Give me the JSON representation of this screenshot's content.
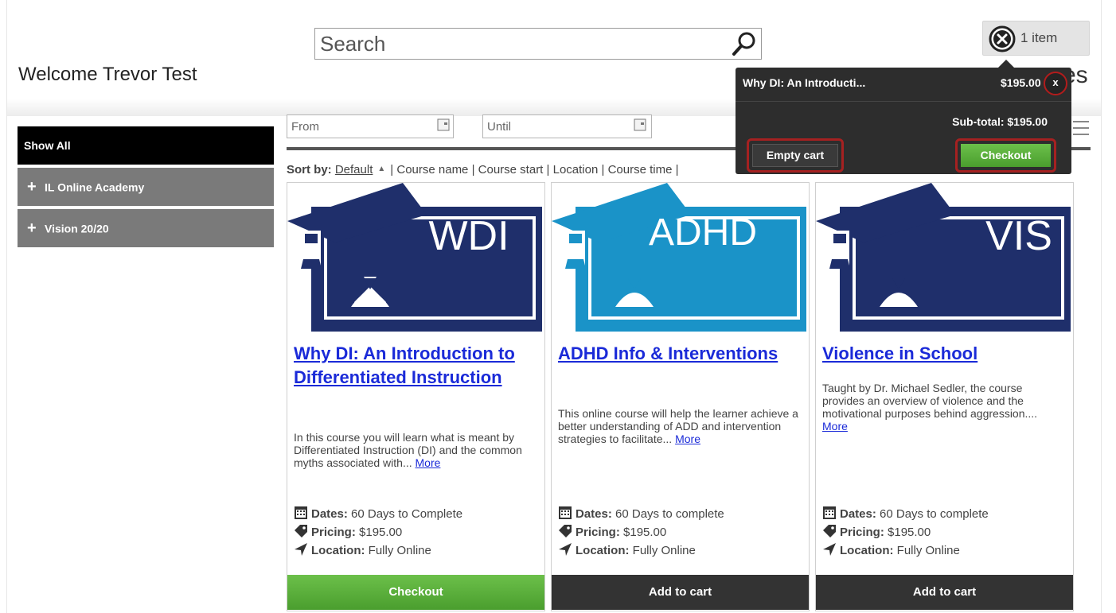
{
  "header": {
    "search_placeholder": "Search",
    "welcome": "Welcome Trevor Test",
    "cart_label": "1 item",
    "title_tail": "es"
  },
  "sidebar": {
    "show_all": "Show All",
    "items": [
      {
        "label": "IL Online Academy"
      },
      {
        "label": "Vision 20/20"
      }
    ]
  },
  "filters": {
    "from_placeholder": "From",
    "until_placeholder": "Until"
  },
  "sort": {
    "label": "Sort by:",
    "default": "Default",
    "options": [
      "Course name",
      "Course start",
      "Location",
      "Course time"
    ],
    "separator": "|"
  },
  "cart_popover": {
    "item_name": "Why DI: An Introducti...",
    "item_price": "$195.00",
    "remove_label": "x",
    "subtotal": "Sub-total: $195.00",
    "empty_cart_label": "Empty cart",
    "checkout_label": "Checkout"
  },
  "courses": [
    {
      "badge": "WDI",
      "badge_color": "#1f2f6b",
      "title": "Why DI: An Introduction to Differentiated Instruction",
      "description": "In this course you will learn what is meant by Differentiated Instruction (DI) and the common myths associated with...",
      "more": "More",
      "dates_label": "Dates:",
      "dates": "60 Days to Complete",
      "pricing_label": "Pricing:",
      "pricing": "$195.00",
      "location_label": "Location:",
      "location": "Fully Online",
      "button_label": "Checkout"
    },
    {
      "badge": "ADHD",
      "badge_color": "#1a93c8",
      "title": "ADHD Info & Interventions",
      "description": "This online course will help the learner achieve a better understanding of ADD and intervention strategies to facilitate...",
      "more": "More",
      "dates_label": "Dates:",
      "dates": "60 Days to complete",
      "pricing_label": "Pricing:",
      "pricing": "$195.00",
      "location_label": "Location:",
      "location": "Fully Online",
      "button_label": "Add to cart"
    },
    {
      "badge": "VIS",
      "badge_color": "#1f2f6b",
      "title": "Violence in School",
      "description": "Taught by Dr. Michael Sedler, the course provides an overview of violence and the motivational purposes behind aggression....",
      "more": "More",
      "dates_label": "Dates:",
      "dates": "60 Days to complete",
      "pricing_label": "Pricing:",
      "pricing": "$195.00",
      "location_label": "Location:",
      "location": "Fully Online",
      "button_label": "Add to cart"
    }
  ],
  "colors": {
    "checkout_green": "#5aad3a",
    "dark_button": "#333333",
    "link_blue": "#1a2ad8",
    "highlight_red": "#a52121"
  }
}
